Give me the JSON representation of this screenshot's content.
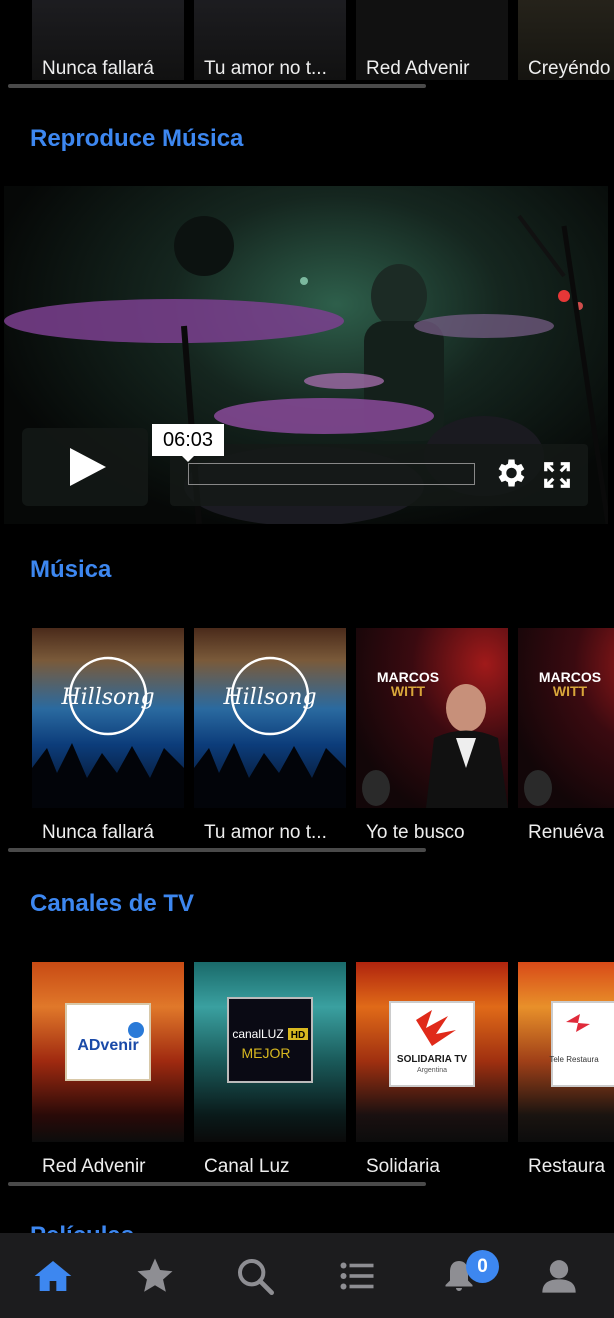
{
  "top_row": {
    "items": [
      {
        "caption": "Nunca fallará"
      },
      {
        "caption": "Tu amor no t..."
      },
      {
        "caption": "Red Advenir"
      },
      {
        "caption": "Creyéndo"
      }
    ]
  },
  "player_section": {
    "title": "Reproduce Música",
    "time": "06:03",
    "icons": {
      "play": "play-icon",
      "settings": "gear-icon",
      "fullscreen": "fullscreen-icon"
    }
  },
  "music_section": {
    "title": "Música",
    "items": [
      {
        "caption": "Nunca fallará",
        "art_label": "Hillsong"
      },
      {
        "caption": "Tu amor no t...",
        "art_label": "Hillsong"
      },
      {
        "caption": "Yo te busco",
        "art_top": "MARCOS",
        "art_bottom": "WITT"
      },
      {
        "caption": "Renuéva",
        "art_top": "MARCOS",
        "art_bottom": "WITT"
      }
    ]
  },
  "tv_section": {
    "title": "Canales de TV",
    "items": [
      {
        "caption": "Red Advenir",
        "logo": "ADvenir"
      },
      {
        "caption": "Canal Luz",
        "logo_a": "canalLUZ",
        "logo_hd": "HD",
        "logo_b": "MEJOR"
      },
      {
        "caption": "Solidaria",
        "logo": "SOLIDARIA TV",
        "logo_sub": "Argentina"
      },
      {
        "caption": "Restaura",
        "logo": "Tele Restaura"
      }
    ]
  },
  "next_section": {
    "title_partial": "Películas"
  },
  "bottom_nav": {
    "items": [
      "home-icon",
      "star-icon",
      "search-icon",
      "list-icon",
      "bell-icon",
      "user-icon"
    ],
    "notification_count": "0",
    "active_color": "#3d87f0",
    "inactive_color": "#8e8e93"
  },
  "colors": {
    "accent": "#3d87f0",
    "background": "#000000"
  }
}
